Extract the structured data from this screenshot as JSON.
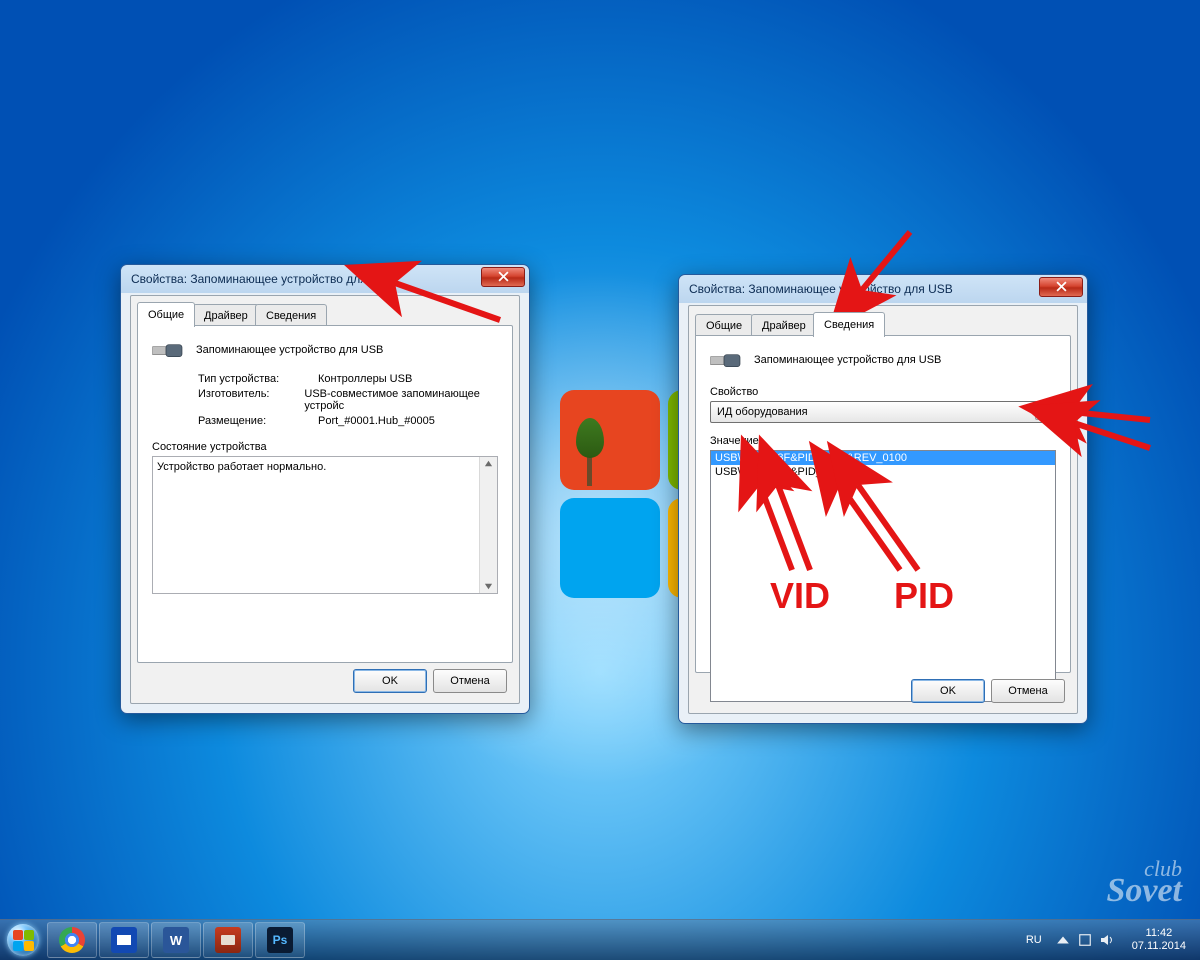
{
  "window_left": {
    "title": "Свойства: Запоминающее устройство для USB",
    "tabs": [
      "Общие",
      "Драйвер",
      "Сведения"
    ],
    "active_tab": 0,
    "device_name": "Запоминающее устройство для USB",
    "props": {
      "type_label": "Тип устройства:",
      "type_value": "Контроллеры USB",
      "manuf_label": "Изготовитель:",
      "manuf_value": "USB-совместимое запоминающее устройс",
      "loc_label": "Размещение:",
      "loc_value": "Port_#0001.Hub_#0005"
    },
    "status_label": "Состояние устройства",
    "status_text": "Устройство работает нормально.",
    "ok": "OK",
    "cancel": "Отмена"
  },
  "window_right": {
    "title": "Свойства: Запоминающее устройство для USB",
    "tabs": [
      "Общие",
      "Драйвер",
      "Сведения"
    ],
    "active_tab": 2,
    "device_name": "Запоминающее устройство для USB",
    "property_label": "Свойство",
    "property_value": "ИД оборудования",
    "value_label": "Значение",
    "value_items": [
      "USB\\VID_058F&PID_6366&REV_0100",
      "USB\\VID_058F&PID_6366"
    ],
    "ok": "OK",
    "cancel": "Отмена"
  },
  "annotations": {
    "vid": "VID",
    "pid": "PID"
  },
  "taskbar": {
    "apps": [
      "chrome",
      "save",
      "word",
      "folder",
      "ps"
    ],
    "word_letter": "W",
    "ps_letters": "Ps",
    "lang": "RU",
    "time": "11:42",
    "date": "07.11.2014"
  },
  "watermark": {
    "line1": "club",
    "line2": "Sovet"
  }
}
